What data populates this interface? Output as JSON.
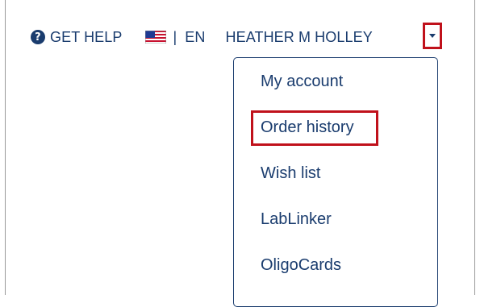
{
  "header": {
    "help_label": "GET HELP",
    "help_icon": "question-circle-icon",
    "flag_icon": "us-flag-icon",
    "separator": "|",
    "language": "EN",
    "user_name": "HEATHER M HOLLEY",
    "caret_icon": "caret-down-icon"
  },
  "account_menu": {
    "items": [
      {
        "label": "My account"
      },
      {
        "label": "Order history"
      },
      {
        "label": "Wish list"
      },
      {
        "label": "LabLinker"
      },
      {
        "label": "OligoCards"
      }
    ]
  },
  "colors": {
    "text": "#1a3c6e",
    "highlight": "#c0111b",
    "background": "#ffffff"
  }
}
